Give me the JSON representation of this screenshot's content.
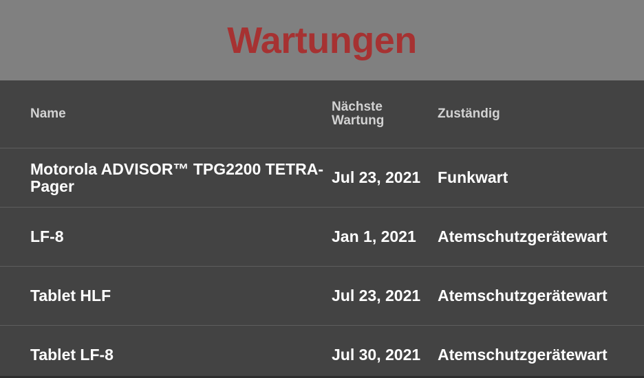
{
  "header": {
    "title": "Wartungen"
  },
  "table": {
    "columns": {
      "name": "Name",
      "next_maintenance": "Nächste Wartung",
      "responsible": "Zuständig"
    },
    "rows": [
      {
        "name": "Motorola ADVISOR™ TPG2200 TETRA-Pager",
        "date": "Jul 23, 2021",
        "responsible": "Funkwart"
      },
      {
        "name": "LF-8",
        "date": "Jan 1, 2021",
        "responsible": "Atemschutzgerätewart"
      },
      {
        "name": "Tablet HLF",
        "date": "Jul 23, 2021",
        "responsible": "Atemschutzgerätewart"
      },
      {
        "name": "Tablet LF-8",
        "date": "Jul 30, 2021",
        "responsible": "Atemschutzgerätewart"
      }
    ]
  },
  "colors": {
    "header_background": "#808080",
    "title": "#a63232",
    "table_background": "#434343",
    "row_divider": "#5e5e5e",
    "text": "#ffffff",
    "column_header_text": "#d2d2d2"
  }
}
